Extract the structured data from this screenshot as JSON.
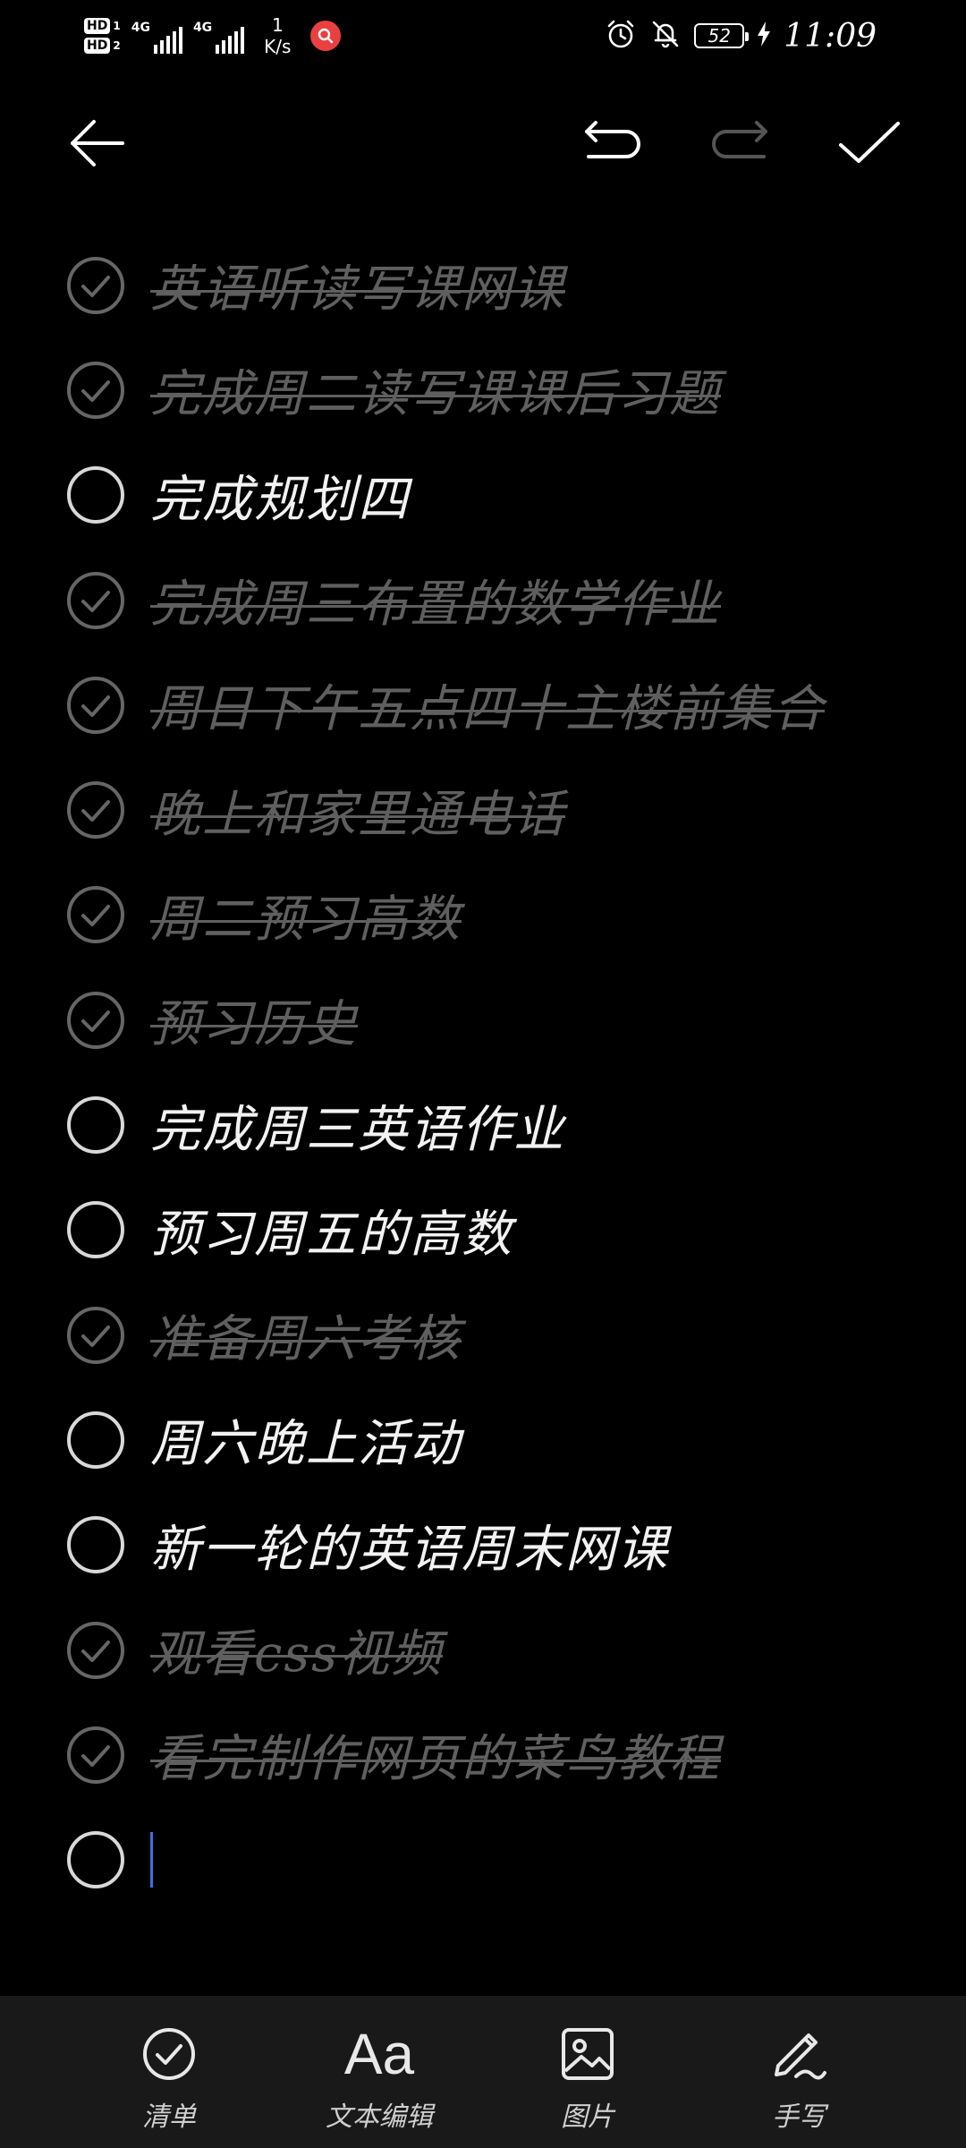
{
  "status_bar": {
    "hd1": "HD",
    "hd1_num": "1",
    "hd2": "HD",
    "hd2_num": "2",
    "net1": "4G",
    "net2": "4G",
    "speed_value": "1",
    "speed_unit": "K/s",
    "battery_level": "52",
    "time": "11:09",
    "icons": [
      "alarm-icon",
      "mute-bell-icon",
      "charging-bolt-icon"
    ]
  },
  "toolbar": {
    "icons": [
      "back-arrow-icon",
      "undo-icon",
      "redo-icon",
      "confirm-check-icon"
    ],
    "redo_enabled": false
  },
  "checklist": {
    "items": [
      {
        "text": "英语听读写课网课",
        "done": true
      },
      {
        "text": "完成周二读写课课后习题",
        "done": true
      },
      {
        "text": "完成规划四",
        "done": false
      },
      {
        "text": "完成周三布置的数学作业",
        "done": true
      },
      {
        "text": "周日下午五点四十主楼前集合",
        "done": true
      },
      {
        "text": "晚上和家里通电话",
        "done": true
      },
      {
        "text": "周二预习高数",
        "done": true
      },
      {
        "text": "预习历史",
        "done": true
      },
      {
        "text": "完成周三英语作业",
        "done": false
      },
      {
        "text": "预习周五的高数",
        "done": false
      },
      {
        "text": "准备周六考核",
        "done": true
      },
      {
        "text": "周六晚上活动",
        "done": false
      },
      {
        "text": "新一轮的英语周末网课",
        "done": false
      },
      {
        "text": "观看css视频",
        "done": true
      },
      {
        "text": "看完制作网页的菜鸟教程",
        "done": true
      }
    ],
    "new_item_value": ""
  },
  "bottom_bar": {
    "items": [
      {
        "label": "清单",
        "icon": "checklist-icon"
      },
      {
        "label": "文本编辑",
        "icon_text": "Aa",
        "icon": "text-format-icon"
      },
      {
        "label": "图片",
        "icon": "image-icon"
      },
      {
        "label": "手写",
        "icon": "handwriting-pen-icon"
      }
    ]
  },
  "colors": {
    "background": "#000000",
    "done_text": "#5f5f5f",
    "open_text": "#f2f2f2",
    "caret": "#3d6fe6",
    "bottom_bar_bg": "#191919"
  }
}
